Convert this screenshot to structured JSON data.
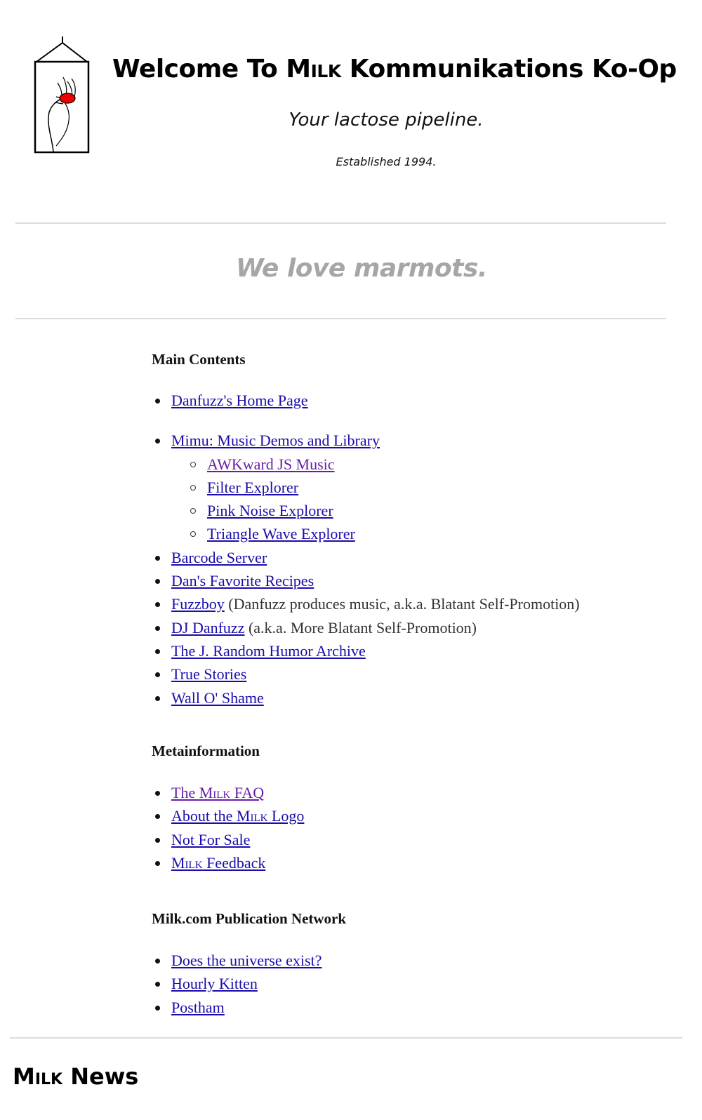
{
  "header": {
    "title_prefix": "Welcome To ",
    "title_brand": "Milk",
    "title_suffix": " Kommunikations Ko-Op",
    "tagline": "Your lactose pipeline.",
    "established": "Established 1994."
  },
  "slogan": "We love marmots.",
  "main_contents": {
    "heading": "Main Contents",
    "items": [
      {
        "label": "Danfuzz's Home Page"
      },
      {
        "label": "Mimu: Music Demos and Library"
      },
      {
        "label": "AWKward JS Music"
      },
      {
        "label": "Filter Explorer"
      },
      {
        "label": "Pink Noise Explorer"
      },
      {
        "label": "Triangle Wave Explorer"
      },
      {
        "label": "Barcode Server"
      },
      {
        "label": "Dan's Favorite Recipes"
      },
      {
        "label": "Fuzzboy",
        "note": " (Danfuzz produces music, a.k.a. Blatant Self-Promotion)"
      },
      {
        "label": "DJ Danfuzz",
        "note": " (a.k.a. More Blatant Self-Promotion)"
      },
      {
        "label": "The J. Random Humor Archive"
      },
      {
        "label": "True Stories"
      },
      {
        "label": "Wall O' Shame"
      }
    ]
  },
  "metainformation": {
    "heading": "Metainformation",
    "items": [
      {
        "pre": "The ",
        "brand": "Milk",
        "post": " FAQ"
      },
      {
        "pre": "About the ",
        "brand": "Milk",
        "post": " Logo"
      },
      {
        "pre": "Not For Sale",
        "brand": "",
        "post": ""
      },
      {
        "pre": "",
        "brand": "Milk",
        "post": " Feedback"
      }
    ]
  },
  "publication_network": {
    "heading": "Milk.com Publication Network",
    "items": [
      {
        "label": "Does the universe exist?"
      },
      {
        "label": "Hourly Kitten"
      },
      {
        "label": "Postham"
      }
    ]
  },
  "news": {
    "heading_brand": "Milk",
    "heading_rest": " News"
  }
}
